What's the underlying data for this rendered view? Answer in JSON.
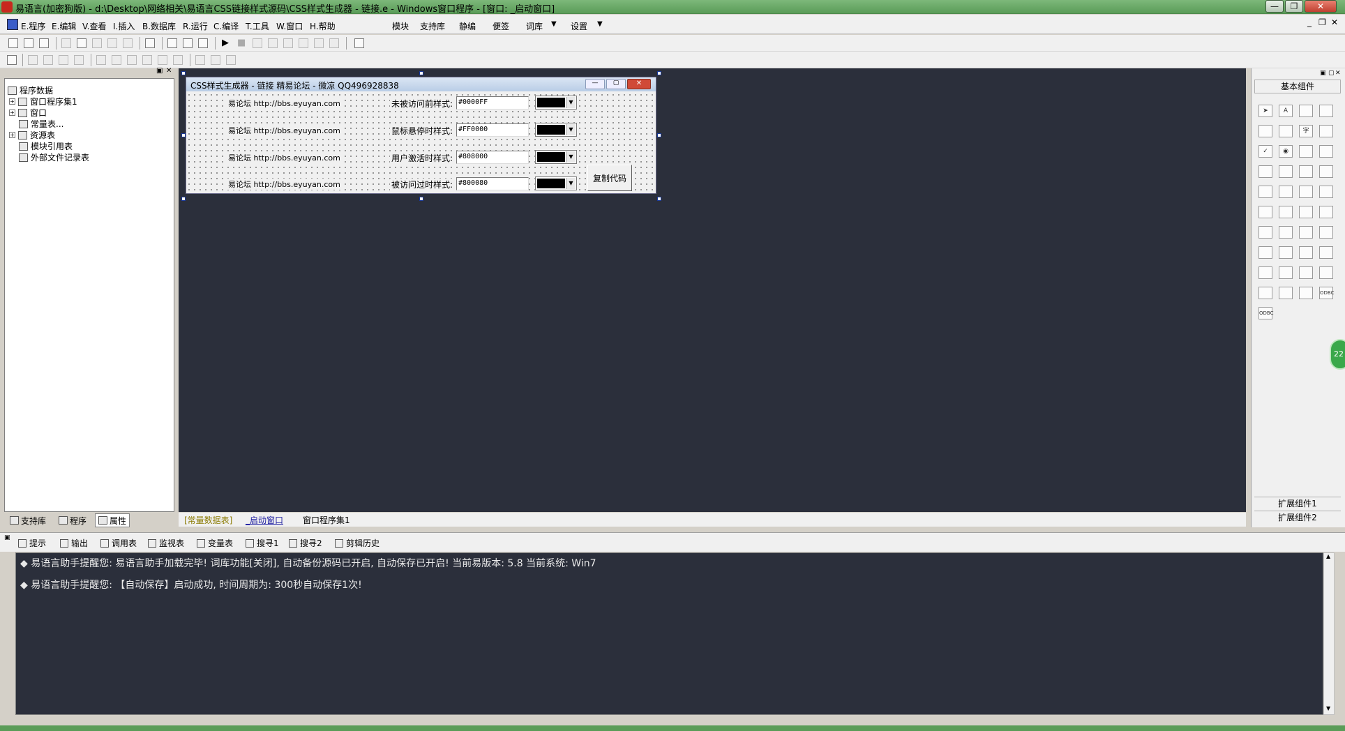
{
  "window": {
    "title": "易语言(加密狗版) - d:\\Desktop\\网络相关\\易语言CSS链接样式源码\\CSS样式生成器 - 链接.e - Windows窗口程序 - [窗口: _启动窗口]"
  },
  "menu": {
    "items": [
      "E.程序",
      "E.编辑",
      "V.查看",
      "I.插入",
      "B.数据库",
      "R.运行",
      "C.编译",
      "T.工具",
      "W.窗口",
      "H.帮助"
    ],
    "extra": [
      "模块",
      "支持库",
      "静编",
      "便签",
      "词库",
      "设置"
    ]
  },
  "left_panel": {
    "tree": [
      "程序数据",
      "窗口程序集1",
      "窗口",
      "常量表...",
      "资源表",
      "模块引用表",
      "外部文件记录表"
    ],
    "tabs": [
      "支持库",
      "程序",
      "属性"
    ]
  },
  "form": {
    "title": "CSS样式生成器 - 链接 精易论坛 - 微凉 QQ496928838",
    "rows": [
      {
        "link": "易论坛 http://bbs.eyuyan.com",
        "label": "未被访问前样式:",
        "value": "#0000FF"
      },
      {
        "link": "易论坛 http://bbs.eyuyan.com",
        "label": "鼠标悬停时样式:",
        "value": "#FF0000"
      },
      {
        "link": "易论坛 http://bbs.eyuyan.com",
        "label": "用户激活时样式:",
        "value": "#808000"
      },
      {
        "link": "易论坛 http://bbs.eyuyan.com",
        "label": "被访问过时样式:",
        "value": "#800080"
      }
    ],
    "copy_button": "复制代码"
  },
  "design_tabs": [
    "[常量数据表]",
    "_启动窗口",
    "窗口程序集1"
  ],
  "right_panel": {
    "header": "基本组件",
    "ext1": "扩展组件1",
    "ext2": "扩展组件2"
  },
  "output_tabs": [
    "提示",
    "输出",
    "调用表",
    "监视表",
    "变量表",
    "搜寻1",
    "搜寻2",
    "剪辑历史"
  ],
  "output_lines": [
    "◆ 易语言助手提醒您:  易语言助手加载完毕!  词库功能[关闭], 自动备份源码已开启, 自动保存已开启!  当前易版本: 5.8  当前系统: Win7",
    "◆ 易语言助手提醒您: 【自动保存】启动成功, 时间周期为: 300秒自动保存1次!"
  ],
  "badge": "22",
  "colors": {
    "title_green": "#5a9c58",
    "dark_bg": "#2b2f3b",
    "swatch": "#000000"
  }
}
